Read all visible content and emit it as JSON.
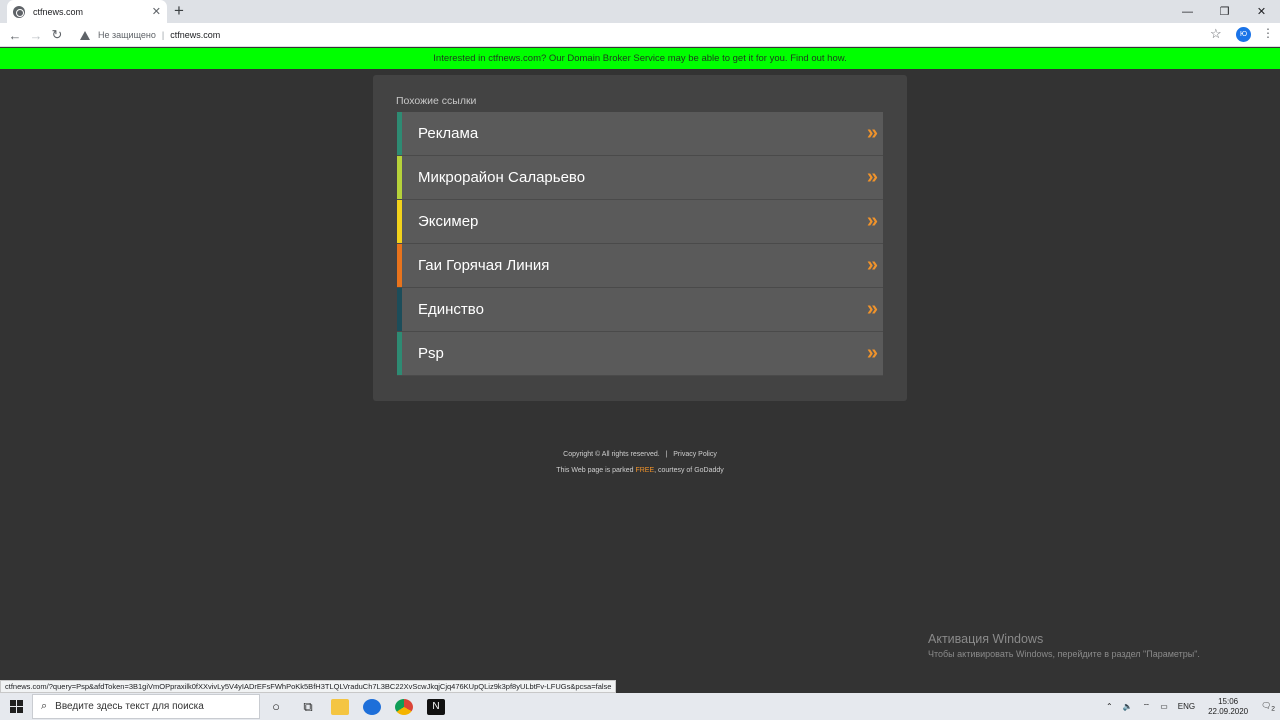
{
  "browser": {
    "tab_title": "ctfnews.com",
    "tab_close": "✕",
    "new_tab": "+",
    "minimize": "—",
    "restore": "❐",
    "close": "✕",
    "not_secure": "Не защищено",
    "separator": "|",
    "url": "ctfnews.com",
    "profile_initials": "Ю"
  },
  "banner": {
    "text": "Interested in ctfnews.com? Our Domain Broker Service may be able to get it for you. Find out how."
  },
  "related": {
    "title": "Похожие ссылки",
    "arrow": "»",
    "links": [
      {
        "label": "Реклама",
        "color": "#2e8b73"
      },
      {
        "label": "Микрорайон Саларьево",
        "color": "#b6d23a"
      },
      {
        "label": "Эксимер",
        "color": "#f2d21b"
      },
      {
        "label": "Гаи Горячая Линия",
        "color": "#e8731c"
      },
      {
        "label": "Единство",
        "color": "#1c4d5a"
      },
      {
        "label": "Psp",
        "color": "#2e8b73"
      }
    ]
  },
  "footer": {
    "copyright": "Copyright ©  All rights reserved.",
    "divider": "|",
    "privacy": "Privacy Policy",
    "parked_prefix": "This Web page is parked ",
    "parked_free": "FREE",
    "parked_suffix": ", courtesy of GoDaddy"
  },
  "activation": {
    "title": "Активация Windows",
    "subtitle": "Чтобы активировать Windows, перейдите в раздел \"Параметры\"."
  },
  "status_url": "ctfnews.com/?query=Psp&afdToken=3B1giVmOPpraxilk0fXXvivLy5V4yIADrEFsFWhPoKk5BfH3TLQLVraduCh7L3BC22XvScwJkqjCjq476KUpQLiz9k3pf8yULbtFv-LFUGs&pcsa=false",
  "taskbar": {
    "search_placeholder": "Введите здесь текст для поиска",
    "lang": "ENG",
    "time": "15:06",
    "date": "22.09.2020",
    "notifications": "2"
  }
}
